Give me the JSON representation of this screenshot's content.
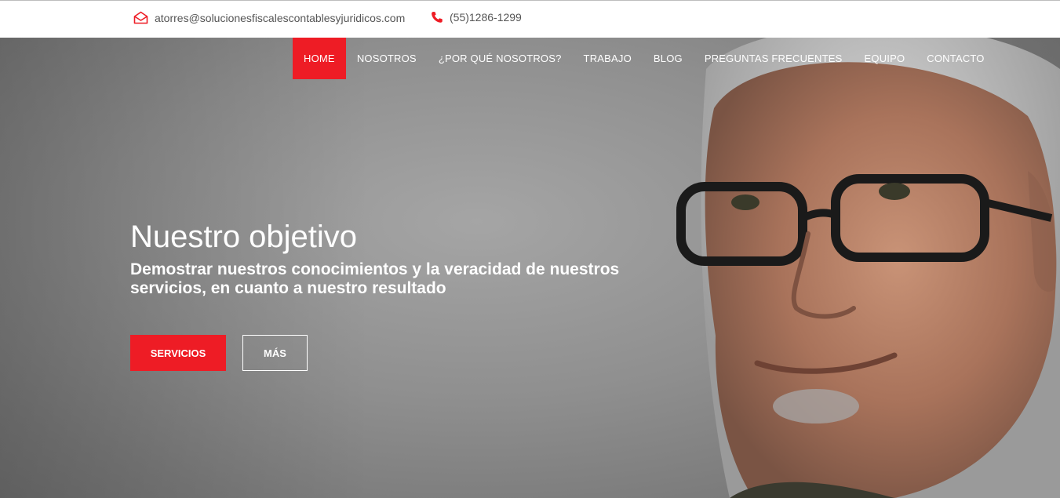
{
  "topbar": {
    "email": "atorres@solucionesfiscalescontablesyjuridicos.com",
    "phone": "(55)1286-1299",
    "email_icon": "envelope-open-icon",
    "phone_icon": "phone-icon"
  },
  "nav": {
    "items": [
      {
        "label": "HOME",
        "active": true
      },
      {
        "label": "NOSOTROS",
        "active": false
      },
      {
        "label": "¿POR QUÉ NOSOTROS?",
        "active": false
      },
      {
        "label": "TRABAJO",
        "active": false
      },
      {
        "label": "BLOG",
        "active": false
      },
      {
        "label": "PREGUNTAS FRECUENTES",
        "active": false
      },
      {
        "label": "EQUIPO",
        "active": false
      },
      {
        "label": "CONTACTO",
        "active": false
      }
    ]
  },
  "hero": {
    "title": "Nuestro objetivo",
    "subtitle": "Demostrar nuestros conocimientos y la veracidad de nuestros servicios, en cuanto a nuestro resultado",
    "primary_button": "SERVICIOS",
    "secondary_button": "MÁS"
  },
  "colors": {
    "accent": "#ee1c25",
    "topbar_bg": "#ffffff",
    "text_on_hero": "#ffffff"
  }
}
